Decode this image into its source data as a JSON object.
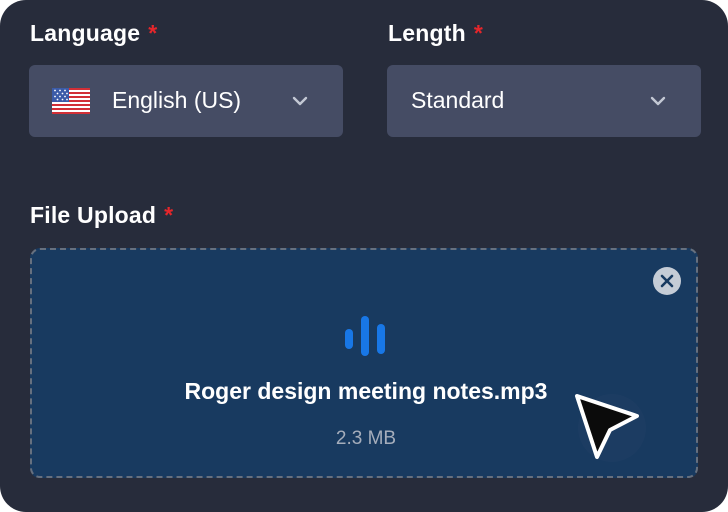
{
  "form": {
    "language": {
      "label": "Language",
      "required_mark": "*",
      "selected": "English (US)",
      "flag_icon": "us-flag-icon"
    },
    "length": {
      "label": "Length",
      "required_mark": "*",
      "selected": "Standard"
    },
    "file_upload": {
      "label": "File Upload",
      "required_mark": "*",
      "file_name": "Roger design meeting notes.mp3",
      "file_size": "2.3 MB",
      "file_icon": "audio-waveform-icon",
      "remove_icon": "close-circle-icon"
    }
  },
  "colors": {
    "background": "#272c3b",
    "select_bg": "#454c64",
    "dropzone_bg": "#183a60",
    "accent": "#1877e6",
    "required": "#e5262b"
  }
}
